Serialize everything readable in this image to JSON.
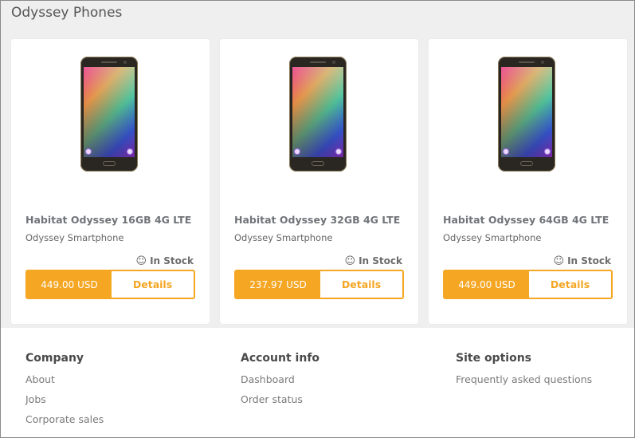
{
  "page": {
    "title": "Odyssey Phones"
  },
  "products": [
    {
      "name": "Habitat Odyssey 16GB 4G LTE",
      "subtitle": "Odyssey Smartphone",
      "stock": "In Stock",
      "price": "449.00 USD",
      "details_label": "Details"
    },
    {
      "name": "Habitat Odyssey 32GB 4G LTE",
      "subtitle": "Odyssey Smartphone",
      "stock": "In Stock",
      "price": "237.97 USD",
      "details_label": "Details"
    },
    {
      "name": "Habitat Odyssey 64GB 4G LTE",
      "subtitle": "Odyssey Smartphone",
      "stock": "In Stock",
      "price": "449.00 USD",
      "details_label": "Details"
    }
  ],
  "footer": {
    "columns": [
      {
        "heading": "Company",
        "links": [
          "About",
          "Jobs",
          "Corporate sales"
        ]
      },
      {
        "heading": "Account info",
        "links": [
          "Dashboard",
          "Order status"
        ]
      },
      {
        "heading": "Site options",
        "links": [
          "Frequently asked questions"
        ]
      }
    ]
  },
  "icons": {
    "stock": "smiley-icon",
    "product_image": "phone-image"
  },
  "colors": {
    "accent": "#f5a623",
    "background": "#efefef",
    "card": "#ffffff"
  }
}
